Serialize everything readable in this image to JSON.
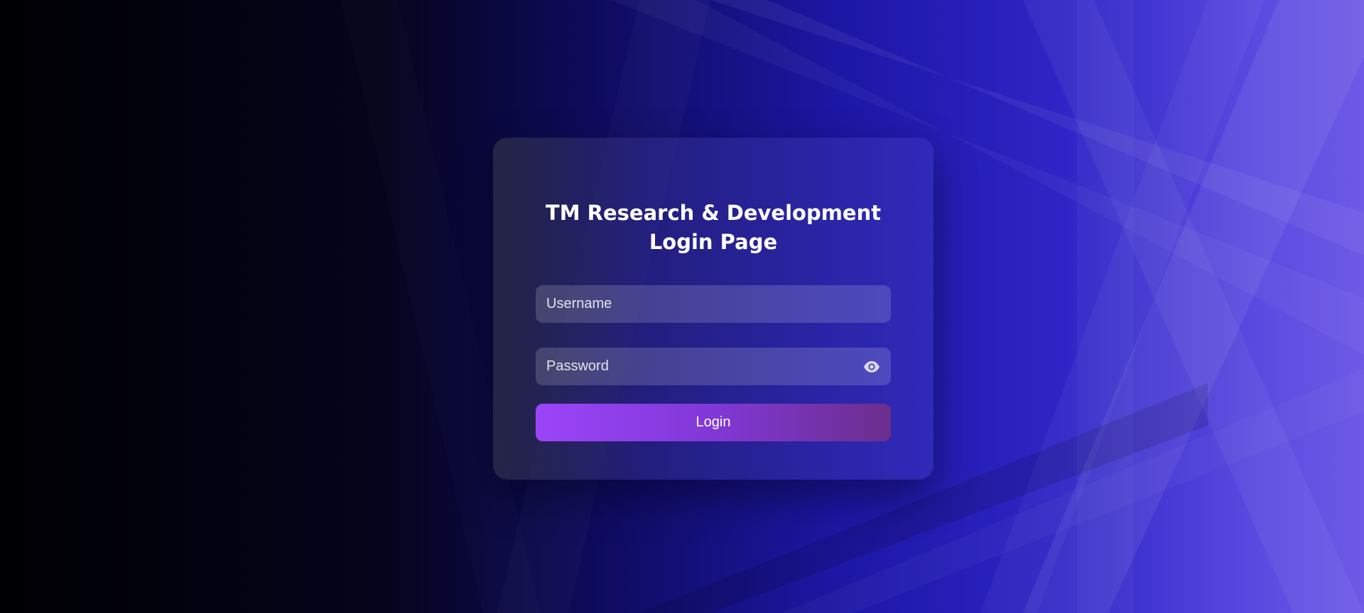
{
  "login": {
    "title_line1": "TM Research & Development",
    "title_line2": "Login Page",
    "username_placeholder": "Username",
    "password_placeholder": "Password",
    "login_label": "Login",
    "password_toggle_icon": "eye-icon"
  },
  "colors": {
    "button_gradient_start": "#9b45f9",
    "button_gradient_end": "#6b2e8c",
    "background_dark": "#000003",
    "background_light": "#6d5ae6"
  }
}
